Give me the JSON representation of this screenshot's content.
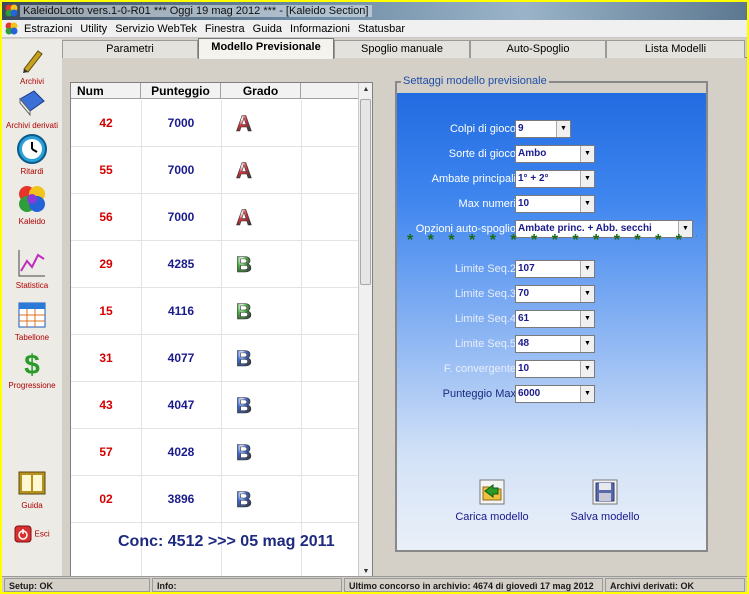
{
  "window": {
    "title": "KaleidoLotto vers.1-0-R01  ***  Oggi 19 mag 2012  ***  - [Kaleido Section]"
  },
  "menu": [
    "Estrazioni",
    "Utility",
    "Servizio WebTek",
    "Finestra",
    "Guida",
    "Informazioni",
    "Statusbar"
  ],
  "sidebar": {
    "archivi": "Archivi",
    "archivi_derivati": "Archivi derivati",
    "ritardi": "Ritardi",
    "kaleido": "Kaleido",
    "statistica": "Statistica",
    "tabellone": "Tabellone",
    "progressione": "Progressione",
    "guida": "Guida",
    "esci": "Esci"
  },
  "tabs": [
    "Parametri",
    "Modello Previsionale",
    "Spoglio manuale",
    "Auto-Spoglio",
    "Lista Modelli"
  ],
  "active_tab": "Modello Previsionale",
  "grid": {
    "headers": {
      "num": "Num",
      "punteggio": "Punteggio",
      "grado": "Grado"
    },
    "rows": [
      {
        "num": "42",
        "punteggio": "7000",
        "grado": "A"
      },
      {
        "num": "55",
        "punteggio": "7000",
        "grado": "A"
      },
      {
        "num": "56",
        "punteggio": "7000",
        "grado": "A"
      },
      {
        "num": "29",
        "punteggio": "4285",
        "grado": "B"
      },
      {
        "num": "15",
        "punteggio": "4116",
        "grado": "B"
      },
      {
        "num": "31",
        "punteggio": "4077",
        "grado": "B"
      },
      {
        "num": "43",
        "punteggio": "4047",
        "grado": "B"
      },
      {
        "num": "57",
        "punteggio": "4028",
        "grado": "B"
      },
      {
        "num": "02",
        "punteggio": "3896",
        "grado": "B"
      }
    ]
  },
  "conc_text": "Conc: 4512 >>> 05 mag 2011",
  "settings": {
    "legend": "Settaggi modello previsionale",
    "fields": {
      "colpi": {
        "label": "Colpi di gioco",
        "value": "9"
      },
      "sorte": {
        "label": "Sorte di gioco",
        "value": "Ambo"
      },
      "ambate": {
        "label": "Ambate principali",
        "value": "1° + 2°"
      },
      "maxnum": {
        "label": "Max numeri",
        "value": "10"
      },
      "opzioni": {
        "label": "Opzioni auto-spoglio",
        "value": "Ambate princ. + Abb. secchi"
      },
      "seq2": {
        "label": "Limite Seq.2",
        "value": "107"
      },
      "seq3": {
        "label": "Limite Seq.3",
        "value": "70"
      },
      "seq4": {
        "label": "Limite Seq.4",
        "value": "61"
      },
      "seq5": {
        "label": "Limite Seq.5",
        "value": "48"
      },
      "fconv": {
        "label": "F. convergente",
        "value": "10"
      },
      "pmax": {
        "label": "Punteggio Max",
        "value": "6000"
      }
    },
    "stars": "* * * * * * * * * * * * * * * * * * *",
    "carica": "Carica modello",
    "salva": "Salva modello"
  },
  "statusbar": {
    "setup": "Setup: OK",
    "info": "Info:",
    "ultimo": "Ultimo concorso in archivio: 4674 di giovedì 17 mag 2012",
    "archivi": "Archivi derivati: OK"
  },
  "colors": {
    "grade_a": "#d8343c",
    "grade_b_green": "#49b545",
    "grade_b_blue": "#3d6ad6",
    "panel_top": "#1f69e0",
    "frame": "#ffff00"
  }
}
